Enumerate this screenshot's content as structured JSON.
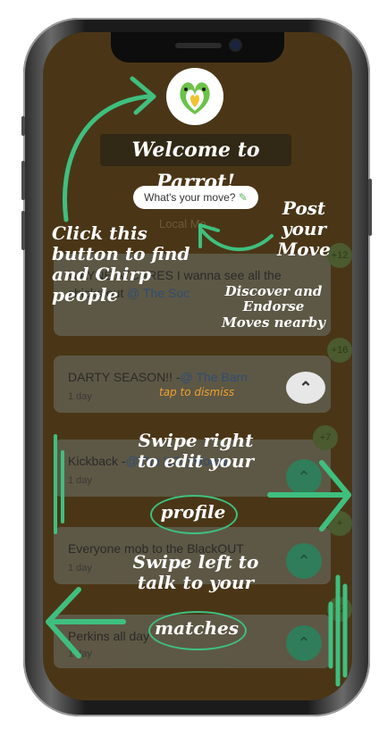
{
  "app": {
    "name": "Parrot"
  },
  "header": {
    "welcome": "Welcome to Parrot!",
    "move_button": "What's your move?",
    "tab_label": "Local Mo..."
  },
  "feed": [
    {
      "text": "WAYNE ATCARES I wanna see all the chicks out ",
      "tag": "@ The Soc",
      "time": "",
      "count": "+12"
    },
    {
      "text": "DARTY SEASON!! -",
      "tag": "@ The Barn",
      "time": "1 day",
      "count": "+16"
    },
    {
      "text": "Kickback -",
      "tag": "@The KOzyHouse",
      "time": "1 day",
      "count": "+7"
    },
    {
      "text": "Everyone mob to the BlackOUT",
      "tag": "",
      "time": "1 day",
      "count": "+"
    },
    {
      "text": "Perkins all day",
      "tag": "",
      "time": "1 day",
      "count": "+2"
    }
  ],
  "annotations": {
    "post_move": "Post your Move",
    "chirp": "Click this button to find and Chirp people",
    "discover": "Discover and Endorse Moves nearby",
    "dismiss": "tap to dismiss",
    "swipe_right": "Swipe right to edit your",
    "profile": "profile",
    "swipe_left": "Swipe left to talk to your",
    "matches": "matches"
  },
  "icons": {
    "up": "chevron-up-icon",
    "pencil": "pencil-icon",
    "logo": "parrot-logo-icon"
  },
  "colors": {
    "accent": "#3fbf7f",
    "screen_overlay": "#4a3617",
    "dismiss": "#f0a030"
  }
}
